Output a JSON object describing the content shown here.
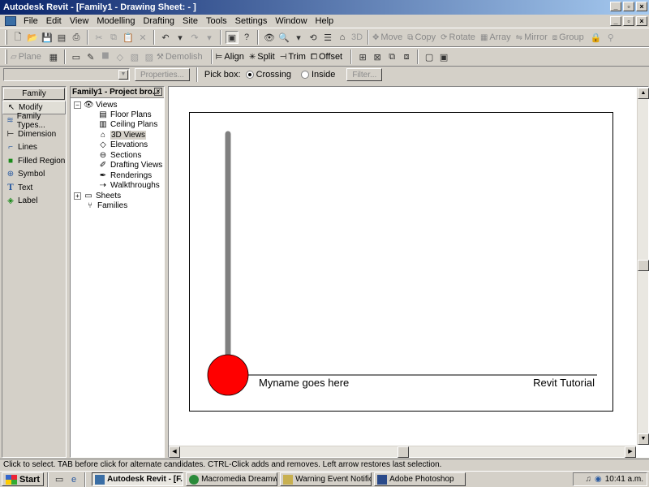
{
  "window": {
    "title": "Autodesk Revit - [Family1 - Drawing Sheet: - ]"
  },
  "menu": [
    "File",
    "Edit",
    "View",
    "Modelling",
    "Drafting",
    "Site",
    "Tools",
    "Settings",
    "Window",
    "Help"
  ],
  "toolbar1": {
    "edit_buttons": [
      "Move",
      "Copy",
      "Rotate",
      "Array",
      "Mirror",
      "Group"
    ]
  },
  "toolbar2": {
    "plane": "Plane",
    "demolish": "Demolish",
    "align": "Align",
    "split": "Split",
    "trim": "Trim",
    "offset": "Offset"
  },
  "options_bar": {
    "combo_value": "",
    "properties": "Properties...",
    "pick_box": "Pick box:",
    "crossing": "Crossing",
    "inside": "Inside",
    "filter": "Filter..."
  },
  "family_panel": {
    "tab": "Family",
    "items": [
      {
        "label": "Modify",
        "icon": "cursor-arrow-icon"
      },
      {
        "label": "Family Types...",
        "icon": "family-types-icon"
      },
      {
        "label": "Dimension",
        "icon": "dimension-icon"
      },
      {
        "label": "Lines",
        "icon": "lines-icon"
      },
      {
        "label": "Filled Region",
        "icon": "filled-region-icon"
      },
      {
        "label": "Symbol",
        "icon": "symbol-icon"
      },
      {
        "label": "Text",
        "icon": "text-icon"
      },
      {
        "label": "Label",
        "icon": "label-icon"
      }
    ]
  },
  "browser": {
    "title": "Family1 - Project bro...",
    "views": "Views",
    "view_items": [
      "Floor Plans",
      "Ceiling Plans",
      "3D Views",
      "Elevations",
      "Sections",
      "Drafting Views",
      "Renderings",
      "Walkthroughs"
    ],
    "sheets": "Sheets",
    "families": "Families"
  },
  "sheet": {
    "name_text": "Myname goes here",
    "title_text": "Revit Tutorial",
    "accent_red": "#ff0000",
    "stem_gray": "#808080"
  },
  "status": {
    "text": "Click to select. TAB before click for alternate candidates. CTRL-Click adds and removes. Left arrow restores last selection."
  },
  "taskbar": {
    "start": "Start",
    "tasks": [
      "Autodesk Revit - [F...",
      "Macromedia Dreamwe...",
      "Warning Event Notific...",
      "Adobe Photoshop"
    ],
    "clock": "10:41 a.m."
  }
}
